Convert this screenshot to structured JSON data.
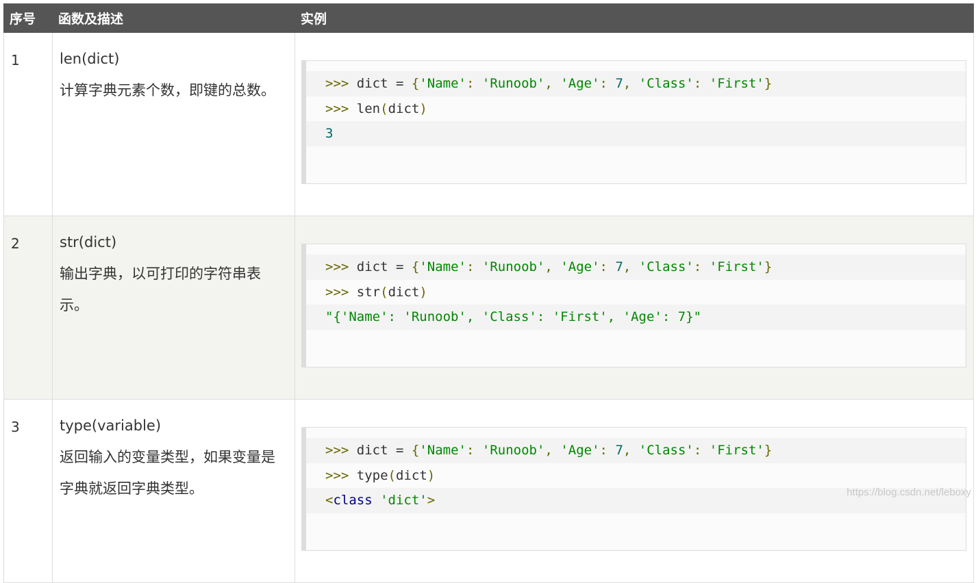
{
  "header": {
    "col1": "序号",
    "col2": "函数及描述",
    "col3": "实例"
  },
  "rows": [
    {
      "num": "1",
      "func": "len(dict)",
      "desc": "计算字典元素个数，即键的总数。",
      "code": [
        ">>> dict = {'Name': 'Runoob', 'Age': 7, 'Class': 'First'}",
        ">>> len(dict)",
        "3"
      ]
    },
    {
      "num": "2",
      "func": "str(dict)",
      "desc": "输出字典，以可打印的字符串表示。",
      "code": [
        ">>> dict = {'Name': 'Runoob', 'Age': 7, 'Class': 'First'}",
        ">>> str(dict)",
        "\"{'Name': 'Runoob', 'Class': 'First', 'Age': 7}\""
      ]
    },
    {
      "num": "3",
      "func": "type(variable)",
      "desc": "返回输入的变量类型，如果变量是字典就返回字典类型。",
      "code": [
        ">>> dict = {'Name': 'Runoob', 'Age': 7, 'Class': 'First'}",
        ">>> type(dict)",
        "<class 'dict'>"
      ]
    }
  ],
  "watermark": "https://blog.csdn.net/leboxy",
  "colors": {
    "header_bg": "#555555",
    "string": "#008800",
    "number": "#006666",
    "keyword": "#000088",
    "punct": "#666600"
  }
}
